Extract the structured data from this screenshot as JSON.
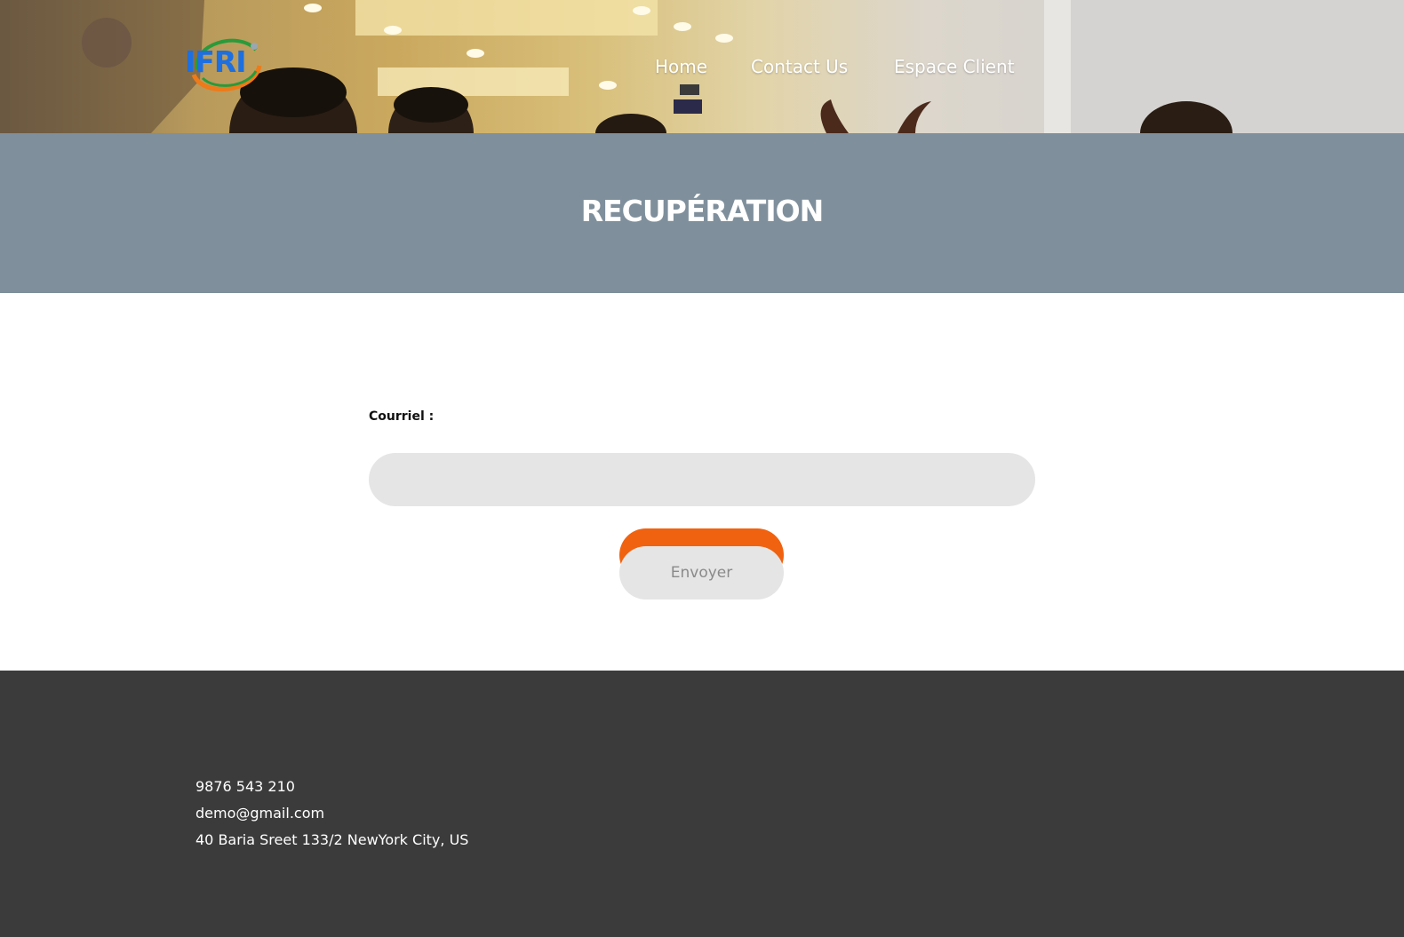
{
  "header": {
    "logo_text": "IFRI",
    "nav": [
      {
        "label": "Home"
      },
      {
        "label": "Contact Us"
      },
      {
        "label": "Espace Client"
      }
    ]
  },
  "banner": {
    "title": "RECUPÉRATION"
  },
  "form": {
    "email_label": "Courriel :",
    "email_value": "",
    "submit_label": "Envoyer"
  },
  "footer": {
    "phone": "9876 543 210",
    "email": "demo@gmail.com",
    "address": "40 Baria Sreet 133/2 NewYork City, US"
  },
  "colors": {
    "banner": "#7f8f9c",
    "accent": "#f06210",
    "input_bg": "#e5e5e5",
    "footer_bg": "#3b3b3b",
    "logo_blue": "#1e6fe0"
  }
}
